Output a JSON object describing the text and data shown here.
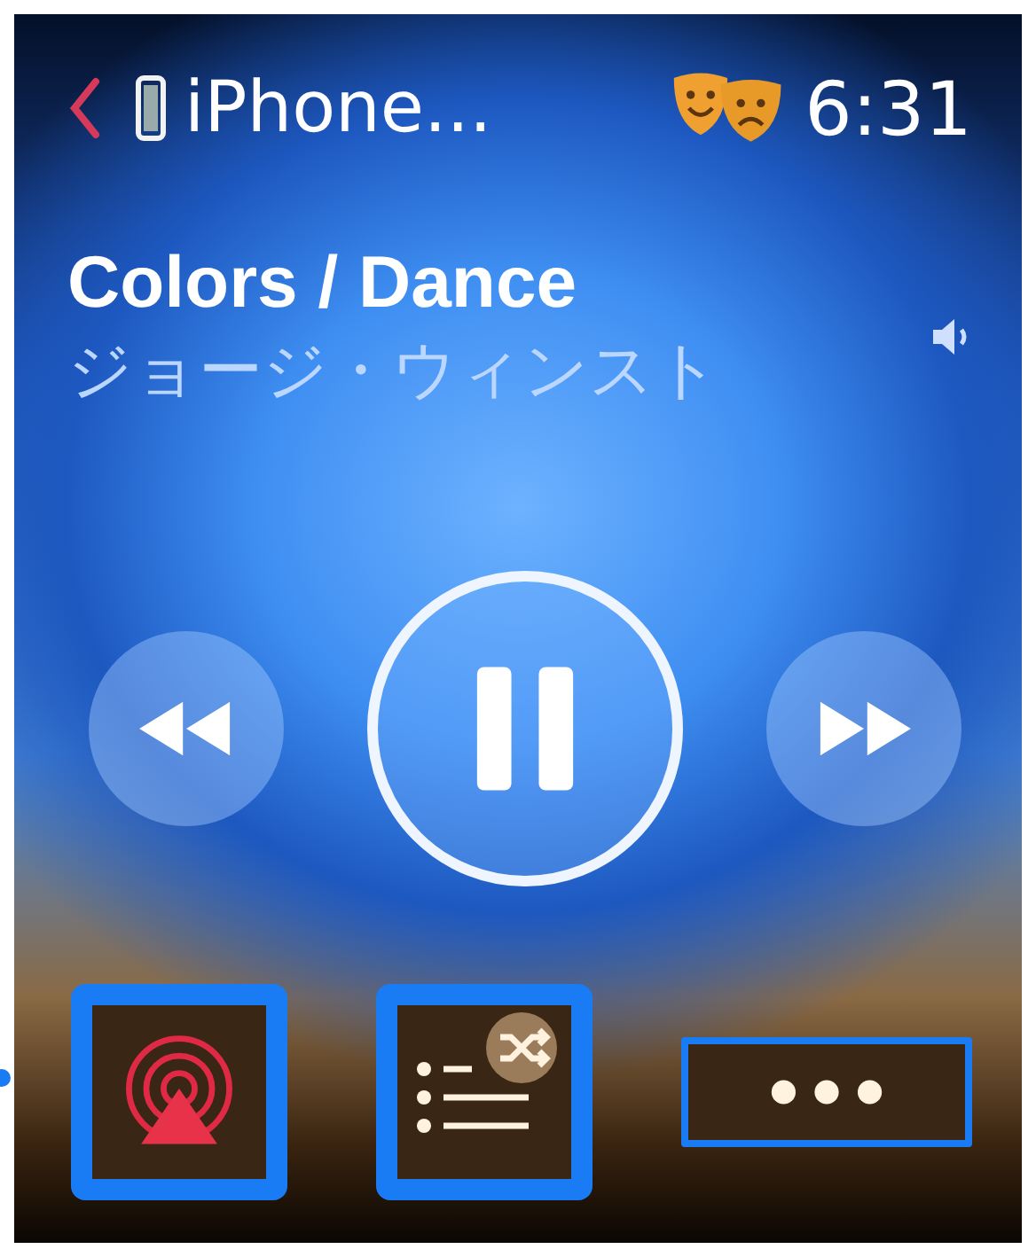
{
  "header": {
    "device": "iPhone...",
    "time": "6:31"
  },
  "track": {
    "title": "Colors / Dance",
    "artist": "ジョージ・ウィンスト"
  },
  "playback": {
    "playing": true
  },
  "controls": [
    {
      "kind": "airplay",
      "highlighted": true,
      "outlined": false
    },
    {
      "kind": "queue",
      "highlighted": true,
      "outlined": false
    },
    {
      "kind": "more",
      "highlighted": false,
      "outlined": true
    }
  ]
}
